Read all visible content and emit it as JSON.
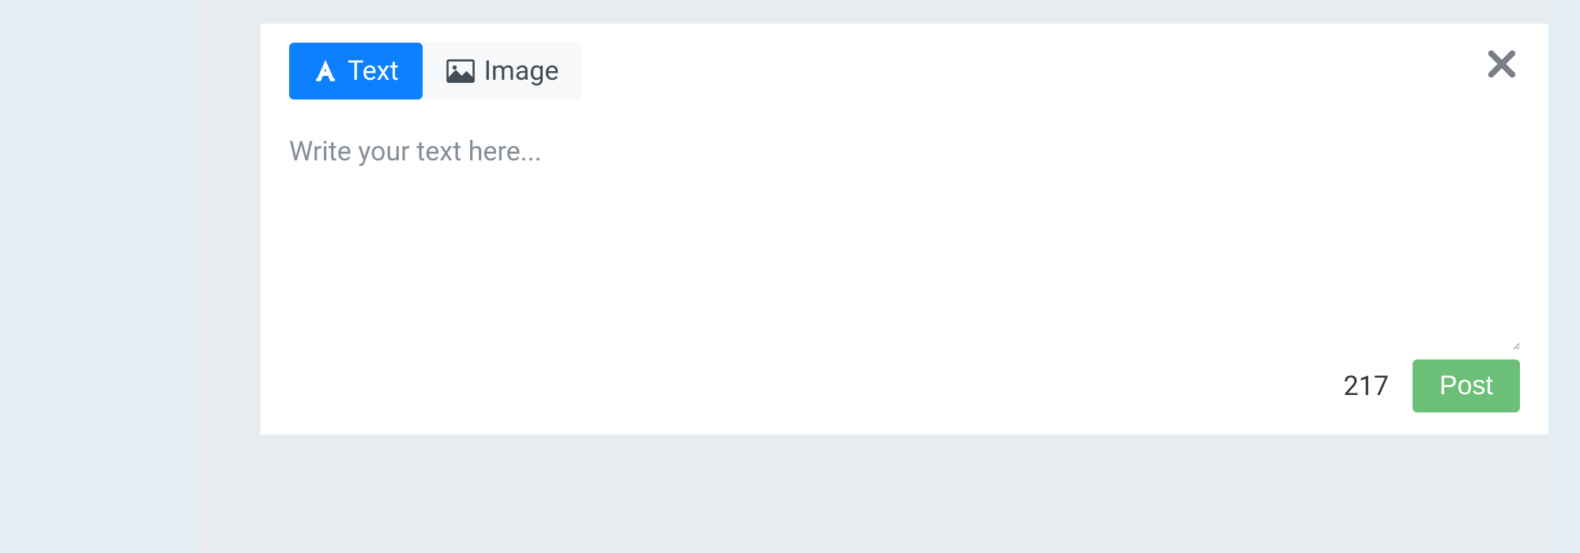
{
  "compose": {
    "tabs": {
      "text": {
        "label": "Text"
      },
      "image": {
        "label": "Image"
      }
    },
    "textarea": {
      "placeholder": "Write your text here...",
      "value": ""
    },
    "char_count": "217",
    "post_label": "Post"
  }
}
